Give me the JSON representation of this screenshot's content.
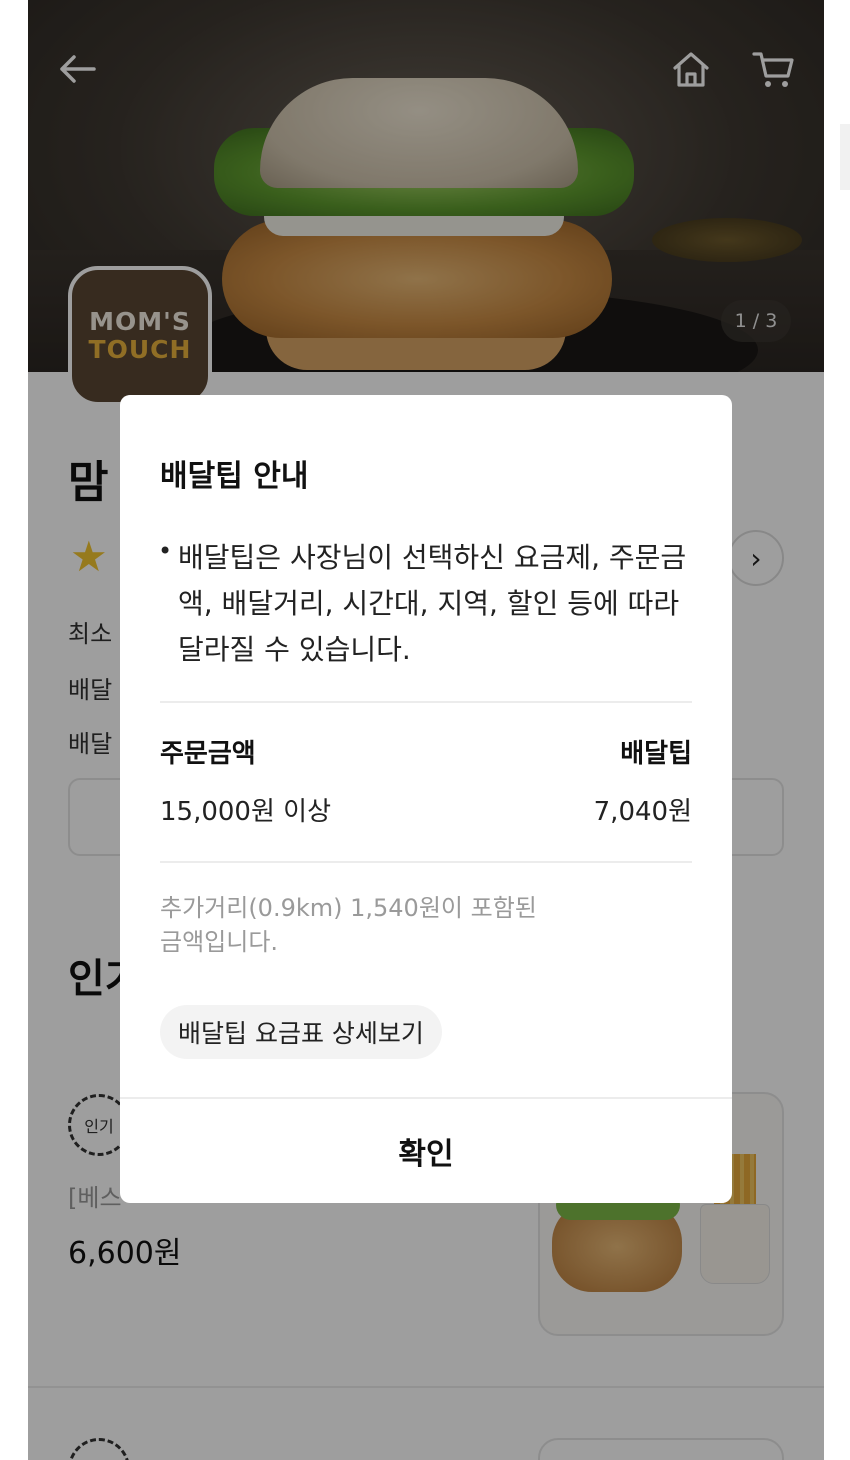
{
  "hero": {
    "page_indicator": "1 / 3"
  },
  "logo": {
    "line1": "MOM'S",
    "line2": "TOUCH"
  },
  "store": {
    "name": "맘"
  },
  "info": {
    "min_order_label": "최소",
    "delivery_label_1": "배달",
    "delivery_label_2": "배달"
  },
  "section": {
    "title": "인기"
  },
  "menu": {
    "badge": "인기",
    "description": "[베스",
    "price": "6,600원"
  },
  "modal": {
    "title": "배달팁 안내",
    "bullet": "•",
    "body": "배달팁은 사장님이 선택하신 요금제, 주문금액, 배달거리, 시간대, 지역, 할인 등에 따라 달라질 수 있습니다.",
    "col_order": "주문금액",
    "col_tip": "배달팁",
    "order_amount": "15,000원 이상",
    "tip_amount": "7,040원",
    "note": "추가거리(0.9km) 1,540원이 포함된 금액입니다.",
    "detail_button": "배달팁 요금표 상세보기",
    "confirm_button": "확인"
  },
  "icons": [
    "back-arrow-icon",
    "home-icon",
    "cart-icon",
    "star-icon",
    "chevron-right-icon"
  ],
  "colors": {
    "dim_overlay": "#000000",
    "star": "#f3c531",
    "logo_bg": "#5a4632",
    "logo_accent": "#e9b23d"
  }
}
